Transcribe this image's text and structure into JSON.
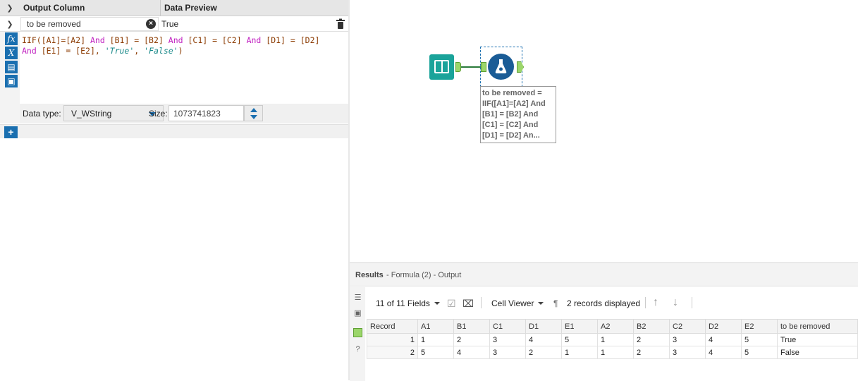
{
  "config": {
    "header": {
      "output_column": "Output Column",
      "data_preview": "Data Preview"
    },
    "row": {
      "output_name": "to be removed",
      "preview": "True"
    },
    "expression": {
      "tokens": [
        {
          "t": "IIF(",
          "c": "fn"
        },
        {
          "t": "[A1]",
          "c": "fn"
        },
        {
          "t": "=",
          "c": "fn"
        },
        {
          "t": "[A2]",
          "c": "fn"
        },
        {
          "t": " And ",
          "c": "kw"
        },
        {
          "t": "[B1] = [B2]",
          "c": "fn"
        },
        {
          "t": " And ",
          "c": "kw"
        },
        {
          "t": "[C1] = [C2]",
          "c": "fn"
        },
        {
          "t": " And ",
          "c": "kw"
        },
        {
          "t": "[D1] = [D2]\n",
          "c": "fn"
        },
        {
          "t": "And ",
          "c": "kw"
        },
        {
          "t": "[E1] = [E2], ",
          "c": "fn"
        },
        {
          "t": "'True'",
          "c": "str"
        },
        {
          "t": ", ",
          "c": "fn"
        },
        {
          "t": "'False'",
          "c": "str"
        },
        {
          "t": ")",
          "c": "fn"
        }
      ]
    },
    "data_type_label": "Data type:",
    "data_type_value": "V_WString",
    "size_label": "Size:",
    "size_value": "1073741823"
  },
  "canvas": {
    "annotation": "to be removed =\nIIF([A1]=[A2] And\n[B1] = [B2] And\n[C1] = [C2] And\n[D1] = [D2] An..."
  },
  "results": {
    "title": "Results",
    "subtitle": "- Formula (2) - Output",
    "fields": "11 of 11 Fields",
    "viewer": "Cell Viewer",
    "records": "2 records displayed",
    "columns": [
      "Record",
      "A1",
      "B1",
      "C1",
      "D1",
      "E1",
      "A2",
      "B2",
      "C2",
      "D2",
      "E2",
      "to be removed"
    ],
    "rows": [
      [
        "1",
        "1",
        "2",
        "3",
        "4",
        "5",
        "1",
        "2",
        "3",
        "4",
        "5",
        "True"
      ],
      [
        "2",
        "5",
        "4",
        "3",
        "2",
        "1",
        "1",
        "2",
        "3",
        "4",
        "5",
        "False"
      ]
    ]
  },
  "colors": {
    "accent": "#1a6fb0",
    "input_tool": "#1aa39a",
    "formula_tool": "#1a5c96",
    "anchor": "#9bd66a"
  }
}
